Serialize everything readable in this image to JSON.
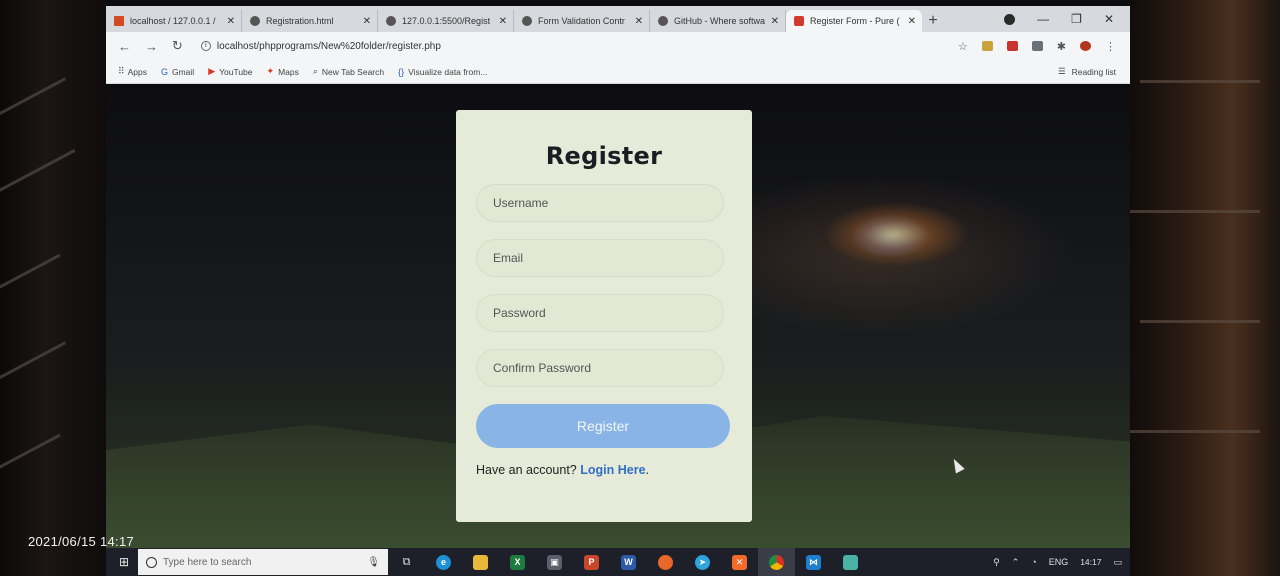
{
  "browser": {
    "tabs": [
      {
        "title": "localhost / 127.0.0.1 /",
        "icon": "phpmyadmin-icon",
        "active": false
      },
      {
        "title": "Registration.html",
        "icon": "globe-icon",
        "active": false
      },
      {
        "title": "127.0.0.1:5500/Regist",
        "icon": "globe-icon",
        "active": false
      },
      {
        "title": "Form Validation Contr",
        "icon": "globe-icon",
        "active": false
      },
      {
        "title": "GitHub - Where softwa",
        "icon": "github-icon",
        "active": false
      },
      {
        "title": "Register Form - Pure (",
        "icon": "html-icon",
        "active": true
      }
    ],
    "url": "localhost/phpprograms/New%20folder/register.php",
    "bookmarks": [
      {
        "label": "Apps",
        "icon": "apps-grid-icon"
      },
      {
        "label": "Gmail",
        "icon": "google-icon"
      },
      {
        "label": "YouTube",
        "icon": "youtube-icon"
      },
      {
        "label": "Maps",
        "icon": "maps-icon"
      },
      {
        "label": "New Tab Search",
        "icon": "search-icon"
      },
      {
        "label": "Visualize data from...",
        "icon": "braces-icon"
      }
    ],
    "reading_list": "Reading list"
  },
  "form": {
    "title": "Register",
    "fields": {
      "username_placeholder": "Username",
      "email_placeholder": "Email",
      "password_placeholder": "Password",
      "confirm_placeholder": "Confirm Password"
    },
    "submit_label": "Register",
    "signin_prefix": "Have an account?",
    "signin_link": "Login Here",
    "signin_suffix": "."
  },
  "taskbar": {
    "search_placeholder": "Type here to search",
    "language": "ENG",
    "time": "14:17"
  },
  "photo_timestamp": "2021/06/15 14:17",
  "colors": {
    "card_bg": "#e6ead8",
    "button_bg": "#88b5e6",
    "link": "#2f6fc6",
    "taskbar_bg": "#1d2028"
  }
}
